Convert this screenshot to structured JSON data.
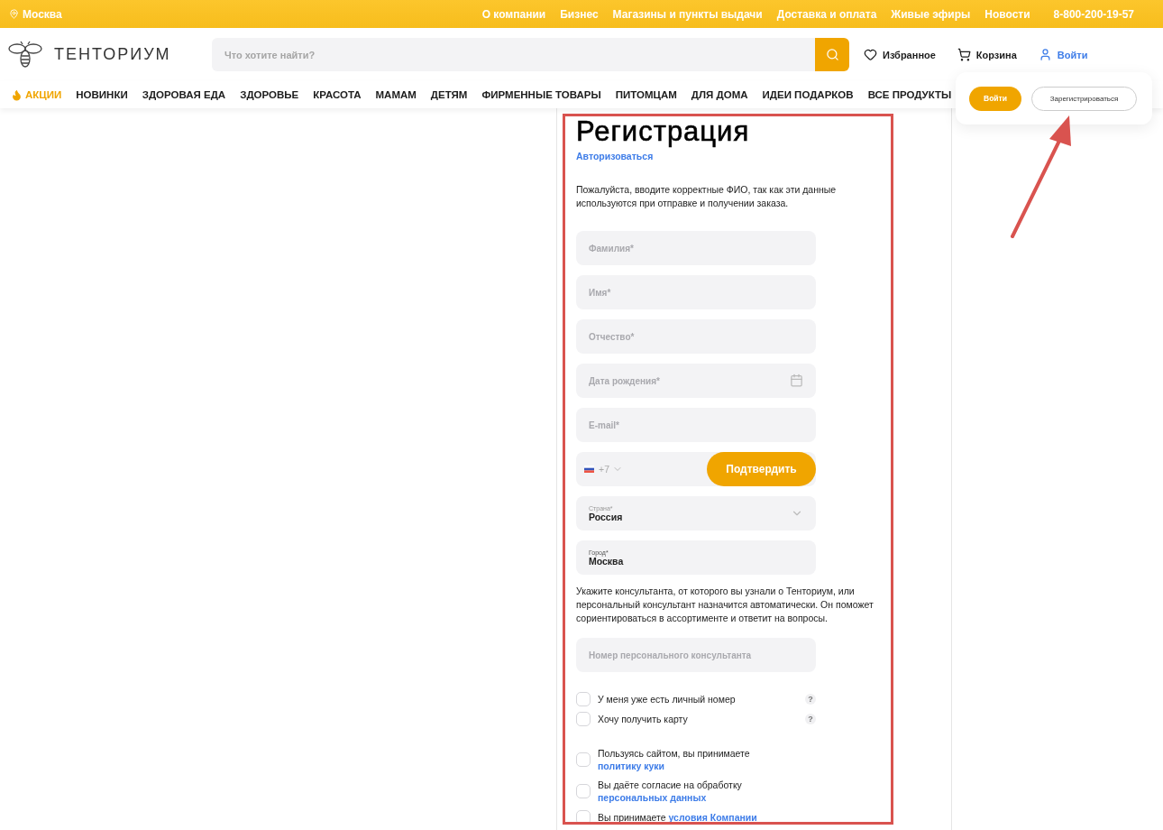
{
  "topbar": {
    "city": "Москва",
    "links": [
      "О компании",
      "Бизнес",
      "Магазины и пункты выдачи",
      "Доставка и оплата",
      "Живые эфиры",
      "Новости"
    ],
    "phone": "8-800-200-19-57"
  },
  "header": {
    "logo": "ТЕНТОРИУМ",
    "search": {
      "placeholder": "Что хотите найти?"
    },
    "actions": [
      {
        "kind": "heart",
        "label": "Избранное"
      },
      {
        "kind": "cart",
        "label": "Корзина"
      },
      {
        "kind": "user",
        "label": "Войти"
      }
    ]
  },
  "nav": [
    {
      "label": "АКЦИИ",
      "kind": "promo"
    },
    {
      "label": "НОВИНКИ",
      "kind": "plain"
    },
    {
      "label": "ЗДОРОВАЯ ЕДА",
      "kind": "plain"
    },
    {
      "label": "ЗДОРОВЬЕ",
      "kind": "plain"
    },
    {
      "label": "КРАСОТА",
      "kind": "plain"
    },
    {
      "label": "МАМАМ",
      "kind": "plain"
    },
    {
      "label": "ДЕТЯМ",
      "kind": "plain"
    },
    {
      "label": "ФИРМЕННЫЕ ТОВАРЫ",
      "kind": "plain"
    },
    {
      "label": "ПИТОМЦАМ",
      "kind": "plain"
    },
    {
      "label": "ДЛЯ ДОМА",
      "kind": "plain"
    },
    {
      "label": "ИДЕИ ПОДАРКОВ",
      "kind": "plain"
    },
    {
      "label": "ВСЕ ПРОДУКТЫ",
      "kind": "plain"
    }
  ],
  "popover": {
    "login": "Войти",
    "register": "Зарегистрироваться"
  },
  "form": {
    "title": "Регистрация",
    "auth_link": "Авторизоваться",
    "intro": "Пожалуйста, вводите корректные ФИО, так как эти данные используются при отправке и получении заказа.",
    "fields": [
      {
        "kind": "text",
        "placeholder": "Фамилия*"
      },
      {
        "kind": "text",
        "placeholder": "Имя*"
      },
      {
        "kind": "text",
        "placeholder": "Отчество*"
      },
      {
        "kind": "date",
        "placeholder": "Дата рождения*"
      },
      {
        "kind": "text",
        "placeholder": "E-mail*"
      },
      {
        "kind": "phone",
        "code": "+7",
        "button": "Подтвердить"
      },
      {
        "kind": "select",
        "label": "Страна*",
        "value": "Россия"
      },
      {
        "kind": "labeled",
        "label": "Город*",
        "value": "Москва"
      }
    ],
    "consultant_note": "Укажите консультанта, от которого вы узнали о Тенториум, или персональный консультант назначится автоматически. Он поможет сориентироваться в ассортименте и ответит на вопросы.",
    "consultant_field": {
      "placeholder": "Номер персонального консультанта"
    },
    "options": [
      {
        "label": "У меня уже есть личный номер",
        "checked": false,
        "help": "?"
      },
      {
        "label": "Хочу получить карту",
        "checked": false,
        "help": "?"
      }
    ],
    "agreements": [
      {
        "text": "Пользуясь сайтом, вы принимаете",
        "link": "политику куки",
        "checked": false
      },
      {
        "text": "Вы даёте согласие на обработку",
        "link": "персональных данных",
        "checked": false
      },
      {
        "text": "Вы принимаете",
        "link": "условия Компании",
        "checked": false
      }
    ]
  }
}
